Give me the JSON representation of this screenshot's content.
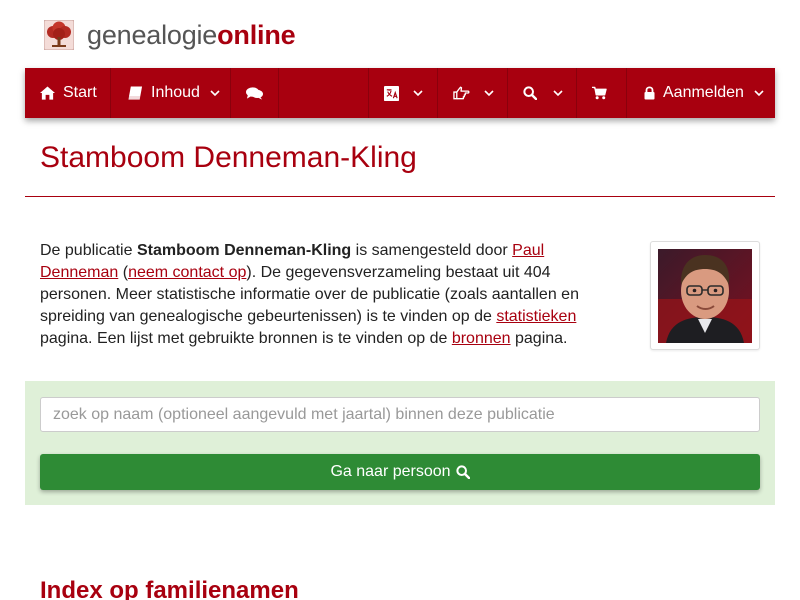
{
  "logo": {
    "text_pre": "genealogie",
    "text_post": "online",
    "icon": "tree-icon"
  },
  "nav": {
    "start_label": "Start",
    "inhoud_label": "Inhoud",
    "login_label": "Aanmelden",
    "icons": [
      "home-icon",
      "book-icon",
      "comments-icon",
      "language-icon",
      "hand-point-icon",
      "search-icon",
      "cart-icon",
      "lock-icon",
      "chevron-down-icon"
    ]
  },
  "page": {
    "title": "Stamboom Denneman-Kling",
    "index_title": "Index op familienamen"
  },
  "intro": {
    "t1": "De publicatie ",
    "pub_name": "Stamboom Denneman-Kling",
    "t2": " is samengesteld door ",
    "author_link": "Paul Denneman",
    "t3": " (",
    "contact_link": "neem contact op",
    "t4": "). De gegevensverzameling bestaat uit 404 personen. Meer statistische informatie over de publicatie (zoals aantallen en spreiding van genealogische gebeurtenissen) is te vinden op de ",
    "stats_link": "statistieken",
    "t5": " pagina. Een lijst met gebruikte bronnen is te vinden op de ",
    "sources_link": "bronnen",
    "t6": " pagina."
  },
  "search": {
    "placeholder": "zoek op naam (optioneel aangevuld met jaartal) binnen deze publicatie",
    "value": "",
    "button_label": "Ga naar persoon"
  },
  "colors": {
    "brand": "#a8000f",
    "search_bg": "#dff0d8",
    "button_green": "#2e8b35"
  }
}
